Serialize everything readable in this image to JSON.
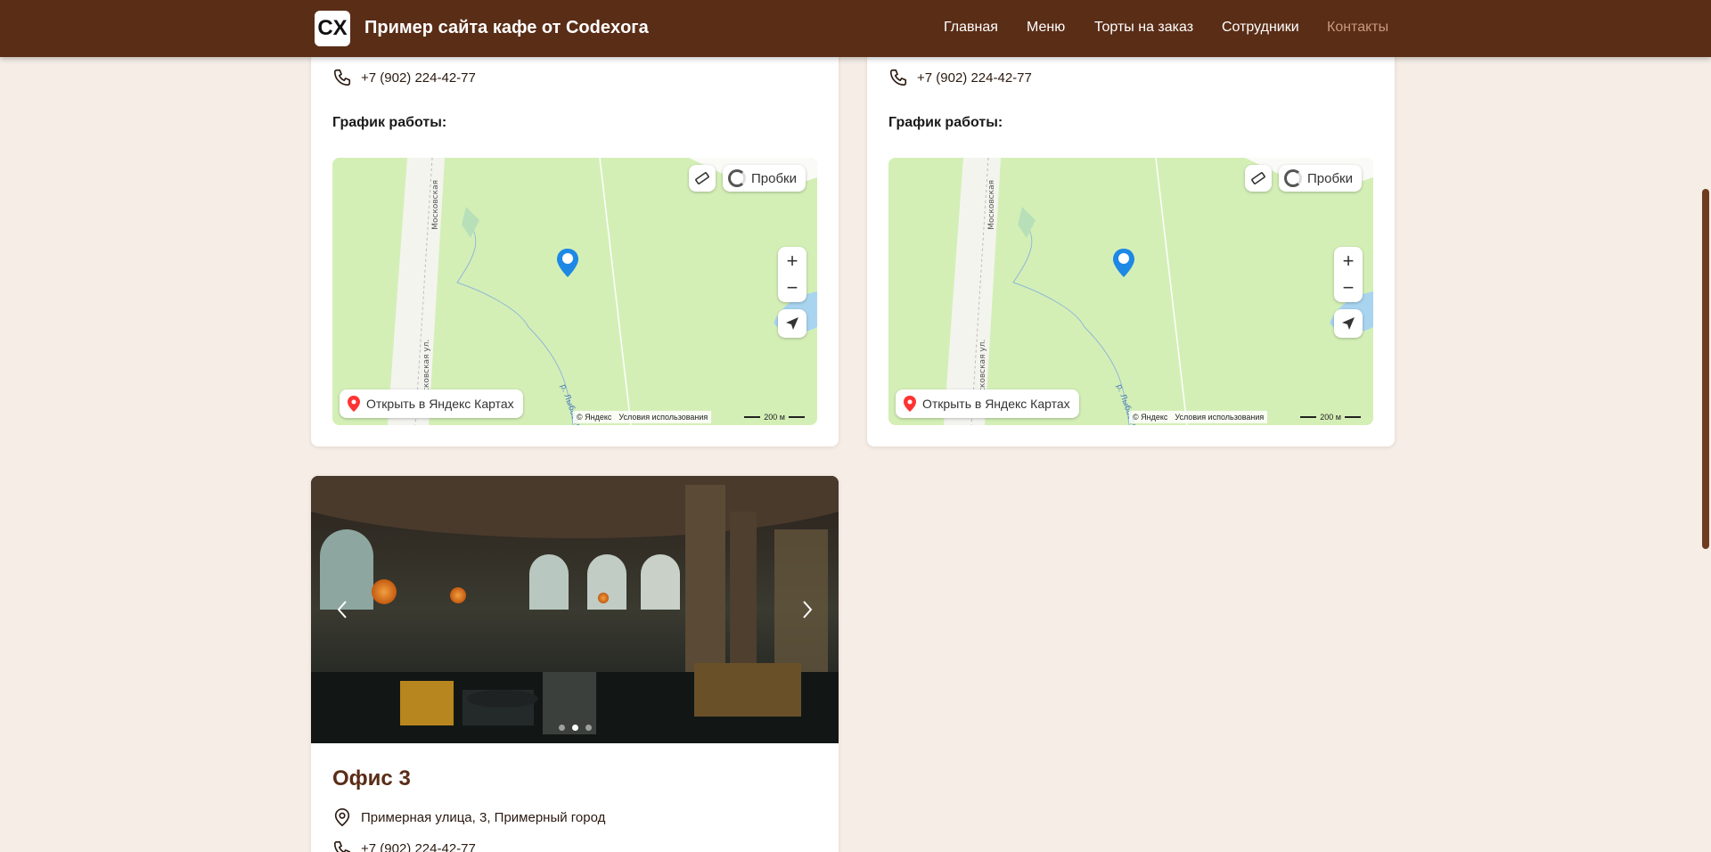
{
  "header": {
    "logo_text": "CX",
    "site_title": "Пример сайта кафе от Codexога",
    "nav": [
      "Главная",
      "Меню",
      "Торты на заказ",
      "Сотрудники",
      "Контакты"
    ],
    "active_nav": "Контакты",
    "colors": {
      "background": "#5a2d17",
      "active": "#c7997a"
    }
  },
  "cards": [
    {
      "phone": "+7 (902) 224-42-77",
      "schedule_label": "График работы:",
      "map": {
        "traffic_label": "Пробки",
        "zoom_in": "+",
        "zoom_out": "−",
        "open_label": "Открыть в Яндекс Картах",
        "copyright": "© Яндекс",
        "terms": "Условия использования",
        "scale": "200 м",
        "street_label": "Московская ул.",
        "street_label_top": "Московская",
        "river_label": "р. Лыбосек"
      }
    },
    {
      "phone": "+7 (902) 224-42-77",
      "schedule_label": "График работы:",
      "map": {
        "traffic_label": "Пробки",
        "zoom_in": "+",
        "zoom_out": "−",
        "open_label": "Открыть в Яндекс Картах",
        "copyright": "© Яндекс",
        "terms": "Условия использования",
        "scale": "200 м",
        "street_label": "Московская ул.",
        "street_label_top": "Московская",
        "river_label": "р. Лыбосек"
      }
    }
  ],
  "office3": {
    "title": "Офис 3",
    "address": "Примерная улица, 3, Примерный город",
    "phone": "+7 (902) 224-42-77",
    "carousel": {
      "slide_count": 3,
      "active_slide": 2
    }
  },
  "icons": [
    "phone-icon",
    "location-pin-icon",
    "ruler-icon",
    "traffic-icon",
    "navigate-arrow-icon",
    "map-marker-icon",
    "chevron-left-icon",
    "chevron-right-icon"
  ]
}
